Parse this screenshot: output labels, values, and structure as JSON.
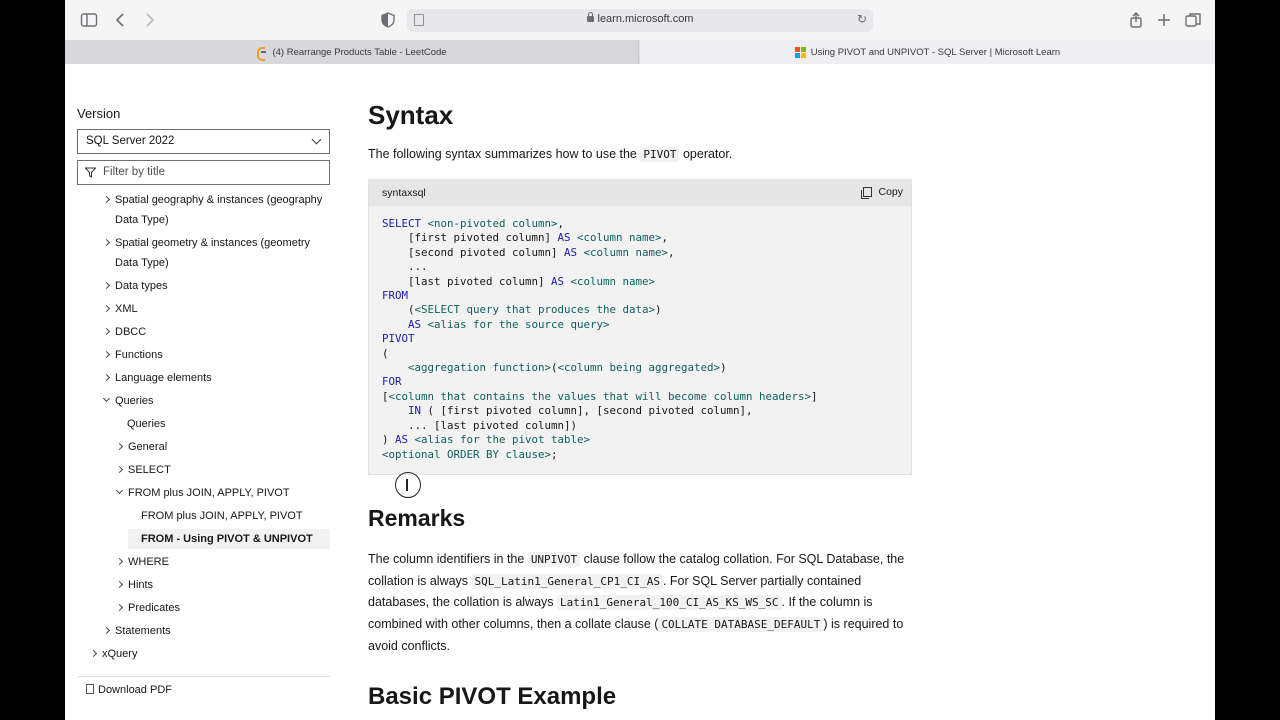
{
  "browser": {
    "url": "learn.microsoft.com",
    "tabs": [
      {
        "title": "(4) Rearrange Products Table - LeetCode"
      },
      {
        "title": "Using PIVOT and UNPIVOT - SQL Server | Microsoft Learn"
      }
    ]
  },
  "nav": {
    "version_label": "Version",
    "version_value": "SQL Server 2022",
    "filter_placeholder": "Filter by title",
    "items": [
      {
        "label": "Spatial geography & instances (geography"
      },
      {
        "label": "Data Type)"
      },
      {
        "label": "Spatial geometry & instances (geometry"
      },
      {
        "label": "Data Type)"
      },
      {
        "label": "Data types"
      },
      {
        "label": "XML"
      },
      {
        "label": "DBCC"
      },
      {
        "label": "Functions"
      },
      {
        "label": "Language elements"
      },
      {
        "label": "Queries"
      },
      {
        "label": "Queries"
      },
      {
        "label": "General"
      },
      {
        "label": "SELECT"
      },
      {
        "label": "FROM plus JOIN, APPLY, PIVOT"
      },
      {
        "label": "FROM plus JOIN, APPLY, PIVOT"
      },
      {
        "label": "FROM - Using PIVOT & UNPIVOT"
      },
      {
        "label": "WHERE"
      },
      {
        "label": "Hints"
      },
      {
        "label": "Predicates"
      },
      {
        "label": "Statements"
      },
      {
        "label": "xQuery"
      }
    ],
    "download_label": "Download PDF"
  },
  "main": {
    "syntax_heading": "Syntax",
    "intro_pre": "The following syntax summarizes how to use the ",
    "intro_code": "PIVOT",
    "intro_post": " operator.",
    "code_lang": "syntaxsql",
    "copy_label": "Copy",
    "code_lines": [
      [
        {
          "t": "SELECT ",
          "c": "kw"
        },
        {
          "t": "<non-pivoted column>",
          "c": "ph"
        },
        {
          "t": ",",
          "c": ""
        }
      ],
      [
        {
          "t": "    [first pivoted column] ",
          "c": ""
        },
        {
          "t": "AS ",
          "c": "kw"
        },
        {
          "t": "<column name>",
          "c": "ph"
        },
        {
          "t": ",",
          "c": ""
        }
      ],
      [
        {
          "t": "    [second pivoted column] ",
          "c": ""
        },
        {
          "t": "AS ",
          "c": "kw"
        },
        {
          "t": "<column name>",
          "c": "ph"
        },
        {
          "t": ",",
          "c": ""
        }
      ],
      [
        {
          "t": "    ...",
          "c": ""
        }
      ],
      [
        {
          "t": "    [last pivoted column] ",
          "c": ""
        },
        {
          "t": "AS ",
          "c": "kw"
        },
        {
          "t": "<column name>",
          "c": "ph"
        }
      ],
      [
        {
          "t": "FROM",
          "c": "kw"
        }
      ],
      [
        {
          "t": "    (",
          "c": ""
        },
        {
          "t": "<SELECT query that produces the data>",
          "c": "ph"
        },
        {
          "t": ")",
          "c": ""
        }
      ],
      [
        {
          "t": "    AS ",
          "c": "kw"
        },
        {
          "t": "<alias for the source query>",
          "c": "ph"
        }
      ],
      [
        {
          "t": "PIVOT",
          "c": "kw"
        }
      ],
      [
        {
          "t": "(",
          "c": ""
        }
      ],
      [
        {
          "t": "    ",
          "c": ""
        },
        {
          "t": "<aggregation function>",
          "c": "ph"
        },
        {
          "t": "(",
          "c": ""
        },
        {
          "t": "<column being aggregated>",
          "c": "ph"
        },
        {
          "t": ")",
          "c": ""
        }
      ],
      [
        {
          "t": "FOR",
          "c": "kw"
        }
      ],
      [
        {
          "t": "[",
          "c": ""
        },
        {
          "t": "<column that contains the values that will become column headers>",
          "c": "ph"
        },
        {
          "t": "]",
          "c": ""
        }
      ],
      [
        {
          "t": "    IN ",
          "c": "kw"
        },
        {
          "t": "( [first pivoted column], [second pivoted column],",
          "c": ""
        }
      ],
      [
        {
          "t": "    ... [last pivoted column])",
          "c": ""
        }
      ],
      [
        {
          "t": ") ",
          "c": ""
        },
        {
          "t": "AS ",
          "c": "kw"
        },
        {
          "t": "<alias for the pivot table>",
          "c": "ph"
        }
      ],
      [
        {
          "t": "<optional ORDER BY clause>",
          "c": "ph"
        },
        {
          "t": ";",
          "c": ""
        }
      ]
    ],
    "remarks_heading": "Remarks",
    "remarks": {
      "p1": "The column identifiers in the ",
      "c1": "UNPIVOT",
      "p2": " clause follow the catalog collation. For SQL Database, the collation is always ",
      "c2": "SQL_Latin1_General_CP1_CI_AS",
      "p3": ". For SQL Server partially contained databases, the collation is always ",
      "c3": "Latin1_General_100_CI_AS_KS_WS_SC",
      "p4": ". If the column is combined with other columns, then a collate clause (",
      "c4": "COLLATE DATABASE_DEFAULT",
      "p5": ") is required to avoid conflicts."
    },
    "basic_heading": "Basic PIVOT Example"
  },
  "colors": {
    "keyword": "#1a1aa6",
    "placeholder": "#0f6060",
    "ms_red": "#f25022",
    "ms_green": "#7fba00",
    "ms_blue": "#00a4ef",
    "ms_yellow": "#ffb900"
  }
}
